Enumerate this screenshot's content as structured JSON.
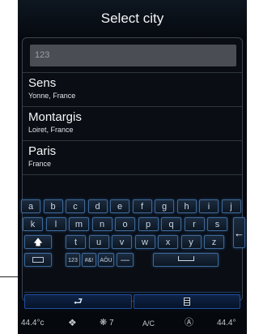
{
  "header": {
    "title": "Select city"
  },
  "search": {
    "value": "123"
  },
  "results": [
    {
      "city": "Sens",
      "region": "Yonne, France"
    },
    {
      "city": "Montargis",
      "region": "Loiret, France"
    },
    {
      "city": "Paris",
      "region": "France"
    }
  ],
  "keyboard": {
    "row1": [
      "a",
      "b",
      "c",
      "d",
      "e",
      "f",
      "g",
      "h",
      "i",
      "j"
    ],
    "row2": [
      "k",
      "l",
      "m",
      "n",
      "o",
      "p",
      "q",
      "r",
      "s"
    ],
    "row3": [
      "t",
      "u",
      "v",
      "w",
      "x",
      "y",
      "z"
    ],
    "shift_icon": "shift-arrow-icon",
    "enter_icon": "enter-arrow-icon",
    "layout_icon": "keyboard-icon",
    "mode_numbers": "123",
    "mode_symbols": "#&!",
    "mode_accents": "AÖU",
    "dash": "—"
  },
  "bottom": {
    "back_icon": "back-arrow-icon",
    "menu_icon": "menu-list-icon"
  },
  "status": {
    "temp_left": "44.4°c",
    "fan_level": "7",
    "ac_label": "A/C",
    "temp_right": "44.4°"
  },
  "colors": {
    "key_border": "#3f6896",
    "background": "#060a10",
    "accent_blue": "#1d4fa0"
  }
}
